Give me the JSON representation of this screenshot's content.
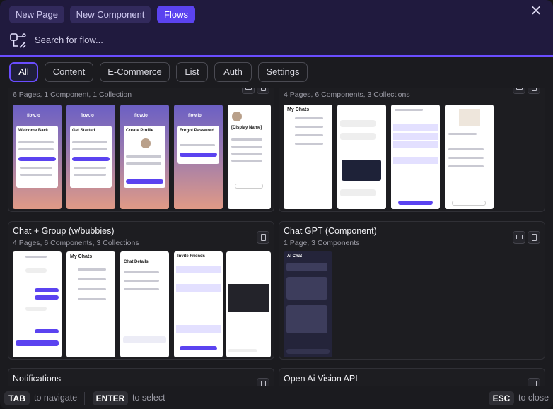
{
  "header": {
    "tabs": [
      {
        "label": "New Page",
        "active": false
      },
      {
        "label": "New Component",
        "active": false
      },
      {
        "label": "Flows",
        "active": true
      }
    ],
    "search_placeholder": "Search for flow..."
  },
  "filters": [
    "All",
    "Content",
    "E-Commerce",
    "List",
    "Auth",
    "Settings"
  ],
  "active_filter": "All",
  "cards": [
    {
      "title": "",
      "subtitle": "6 Pages, 1 Component, 1 Collection"
    },
    {
      "title": "",
      "subtitle": "4 Pages, 6 Components, 3 Collections"
    },
    {
      "title": "Chat + Group (w/bubbies)",
      "subtitle": "4 Pages, 6 Components, 3 Collections"
    },
    {
      "title": "Chat GPT (Component)",
      "subtitle": "1 Page, 3 Components"
    },
    {
      "title": "Notifications",
      "subtitle": ""
    },
    {
      "title": "Open Ai Vision API",
      "subtitle": ""
    }
  ],
  "thumb_text": {
    "auth": [
      "Welcome Back",
      "Get Started",
      "Create Profile",
      "Forgot Password",
      "[Display Name]"
    ],
    "brand": "flow.io",
    "chats": [
      "My Chats",
      "Chat Details",
      "Invite Friends",
      "AI Chat"
    ]
  },
  "footer": {
    "tab_key": "TAB",
    "tab_hint": "to navigate",
    "enter_key": "ENTER",
    "enter_hint": "to select",
    "esc_key": "ESC",
    "esc_hint": "to close"
  },
  "colors": {
    "accent": "#5b43f0",
    "header_bg": "#201a3e",
    "panel_bg": "#1b1b1f"
  },
  "icons": [
    "close-icon",
    "flow-logo-icon",
    "mobile-device-icon",
    "desktop-device-icon"
  ]
}
